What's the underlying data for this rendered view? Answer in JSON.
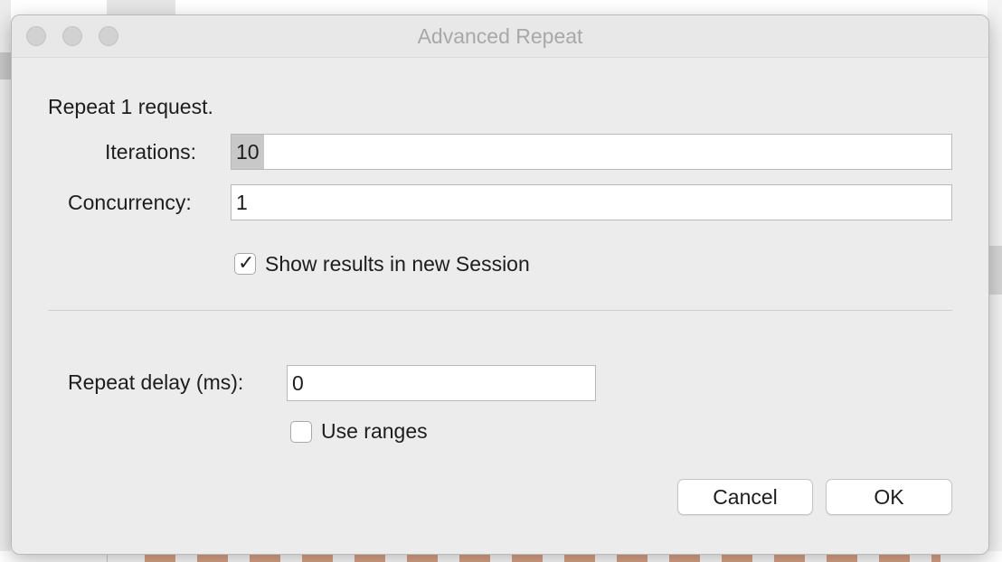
{
  "window": {
    "title": "Advanced Repeat"
  },
  "form": {
    "summary": "Repeat 1 request.",
    "iterations_label": "Iterations:",
    "iterations_value": "10",
    "concurrency_label": "Concurrency:",
    "concurrency_value": "1",
    "show_results_label": "Show results in new Session",
    "show_results_checked": true,
    "repeat_delay_label": "Repeat delay (ms):",
    "repeat_delay_value": "0",
    "use_ranges_label": "Use ranges",
    "use_ranges_checked": false
  },
  "buttons": {
    "cancel": "Cancel",
    "ok": "OK"
  },
  "icons": {
    "checkmark": "checkmark-icon"
  }
}
